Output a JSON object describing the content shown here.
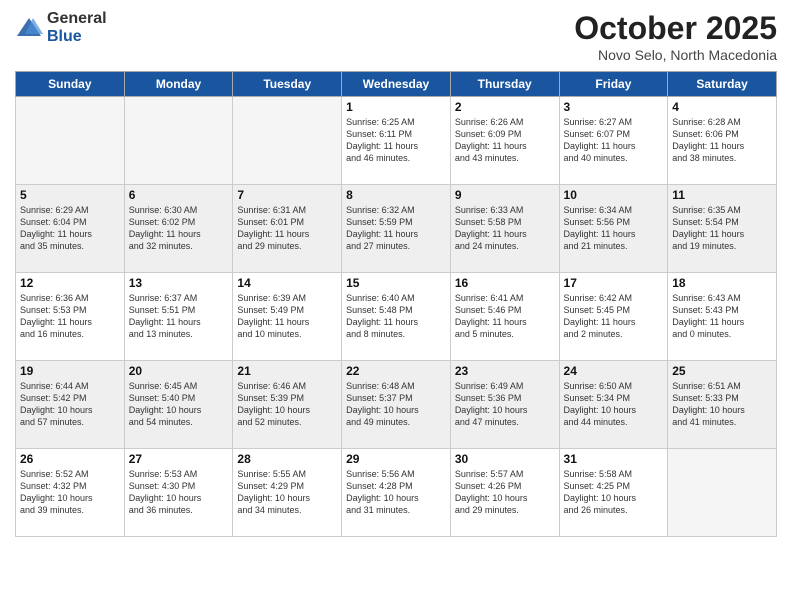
{
  "header": {
    "logo_general": "General",
    "logo_blue": "Blue",
    "month_title": "October 2025",
    "location": "Novo Selo, North Macedonia"
  },
  "weekdays": [
    "Sunday",
    "Monday",
    "Tuesday",
    "Wednesday",
    "Thursday",
    "Friday",
    "Saturday"
  ],
  "weeks": [
    [
      {
        "day": "",
        "info": ""
      },
      {
        "day": "",
        "info": ""
      },
      {
        "day": "",
        "info": ""
      },
      {
        "day": "1",
        "info": "Sunrise: 6:25 AM\nSunset: 6:11 PM\nDaylight: 11 hours\nand 46 minutes."
      },
      {
        "day": "2",
        "info": "Sunrise: 6:26 AM\nSunset: 6:09 PM\nDaylight: 11 hours\nand 43 minutes."
      },
      {
        "day": "3",
        "info": "Sunrise: 6:27 AM\nSunset: 6:07 PM\nDaylight: 11 hours\nand 40 minutes."
      },
      {
        "day": "4",
        "info": "Sunrise: 6:28 AM\nSunset: 6:06 PM\nDaylight: 11 hours\nand 38 minutes."
      }
    ],
    [
      {
        "day": "5",
        "info": "Sunrise: 6:29 AM\nSunset: 6:04 PM\nDaylight: 11 hours\nand 35 minutes."
      },
      {
        "day": "6",
        "info": "Sunrise: 6:30 AM\nSunset: 6:02 PM\nDaylight: 11 hours\nand 32 minutes."
      },
      {
        "day": "7",
        "info": "Sunrise: 6:31 AM\nSunset: 6:01 PM\nDaylight: 11 hours\nand 29 minutes."
      },
      {
        "day": "8",
        "info": "Sunrise: 6:32 AM\nSunset: 5:59 PM\nDaylight: 11 hours\nand 27 minutes."
      },
      {
        "day": "9",
        "info": "Sunrise: 6:33 AM\nSunset: 5:58 PM\nDaylight: 11 hours\nand 24 minutes."
      },
      {
        "day": "10",
        "info": "Sunrise: 6:34 AM\nSunset: 5:56 PM\nDaylight: 11 hours\nand 21 minutes."
      },
      {
        "day": "11",
        "info": "Sunrise: 6:35 AM\nSunset: 5:54 PM\nDaylight: 11 hours\nand 19 minutes."
      }
    ],
    [
      {
        "day": "12",
        "info": "Sunrise: 6:36 AM\nSunset: 5:53 PM\nDaylight: 11 hours\nand 16 minutes."
      },
      {
        "day": "13",
        "info": "Sunrise: 6:37 AM\nSunset: 5:51 PM\nDaylight: 11 hours\nand 13 minutes."
      },
      {
        "day": "14",
        "info": "Sunrise: 6:39 AM\nSunset: 5:49 PM\nDaylight: 11 hours\nand 10 minutes."
      },
      {
        "day": "15",
        "info": "Sunrise: 6:40 AM\nSunset: 5:48 PM\nDaylight: 11 hours\nand 8 minutes."
      },
      {
        "day": "16",
        "info": "Sunrise: 6:41 AM\nSunset: 5:46 PM\nDaylight: 11 hours\nand 5 minutes."
      },
      {
        "day": "17",
        "info": "Sunrise: 6:42 AM\nSunset: 5:45 PM\nDaylight: 11 hours\nand 2 minutes."
      },
      {
        "day": "18",
        "info": "Sunrise: 6:43 AM\nSunset: 5:43 PM\nDaylight: 11 hours\nand 0 minutes."
      }
    ],
    [
      {
        "day": "19",
        "info": "Sunrise: 6:44 AM\nSunset: 5:42 PM\nDaylight: 10 hours\nand 57 minutes."
      },
      {
        "day": "20",
        "info": "Sunrise: 6:45 AM\nSunset: 5:40 PM\nDaylight: 10 hours\nand 54 minutes."
      },
      {
        "day": "21",
        "info": "Sunrise: 6:46 AM\nSunset: 5:39 PM\nDaylight: 10 hours\nand 52 minutes."
      },
      {
        "day": "22",
        "info": "Sunrise: 6:48 AM\nSunset: 5:37 PM\nDaylight: 10 hours\nand 49 minutes."
      },
      {
        "day": "23",
        "info": "Sunrise: 6:49 AM\nSunset: 5:36 PM\nDaylight: 10 hours\nand 47 minutes."
      },
      {
        "day": "24",
        "info": "Sunrise: 6:50 AM\nSunset: 5:34 PM\nDaylight: 10 hours\nand 44 minutes."
      },
      {
        "day": "25",
        "info": "Sunrise: 6:51 AM\nSunset: 5:33 PM\nDaylight: 10 hours\nand 41 minutes."
      }
    ],
    [
      {
        "day": "26",
        "info": "Sunrise: 5:52 AM\nSunset: 4:32 PM\nDaylight: 10 hours\nand 39 minutes."
      },
      {
        "day": "27",
        "info": "Sunrise: 5:53 AM\nSunset: 4:30 PM\nDaylight: 10 hours\nand 36 minutes."
      },
      {
        "day": "28",
        "info": "Sunrise: 5:55 AM\nSunset: 4:29 PM\nDaylight: 10 hours\nand 34 minutes."
      },
      {
        "day": "29",
        "info": "Sunrise: 5:56 AM\nSunset: 4:28 PM\nDaylight: 10 hours\nand 31 minutes."
      },
      {
        "day": "30",
        "info": "Sunrise: 5:57 AM\nSunset: 4:26 PM\nDaylight: 10 hours\nand 29 minutes."
      },
      {
        "day": "31",
        "info": "Sunrise: 5:58 AM\nSunset: 4:25 PM\nDaylight: 10 hours\nand 26 minutes."
      },
      {
        "day": "",
        "info": ""
      }
    ]
  ]
}
